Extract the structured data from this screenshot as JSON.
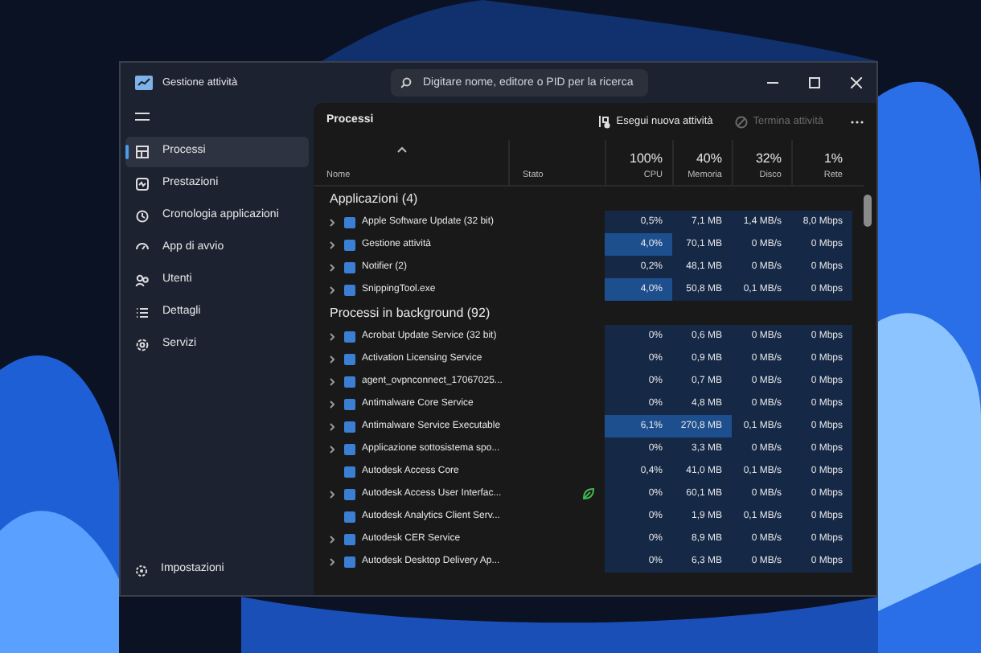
{
  "window": {
    "title": "Gestione attività",
    "search": {
      "placeholder": "Digitare nome, editore o PID per la ricerca"
    }
  },
  "sidebar": {
    "items": [
      {
        "label": "Processi",
        "selected": true
      },
      {
        "label": "Prestazioni",
        "selected": false
      },
      {
        "label": "Cronologia applicazioni",
        "selected": false
      },
      {
        "label": "App di avvio",
        "selected": false
      },
      {
        "label": "Utenti",
        "selected": false
      },
      {
        "label": "Dettagli",
        "selected": false
      },
      {
        "label": "Servizi",
        "selected": false
      }
    ],
    "settings": "Impostazioni"
  },
  "toolbar": {
    "title": "Processi",
    "run_task": "Esegui nuova attività",
    "end_task": {
      "label": "Termina attività",
      "disabled": true
    }
  },
  "table": {
    "columns": [
      {
        "label": "Nome"
      },
      {
        "label": "Stato"
      },
      {
        "label": "CPU",
        "usage": "100%"
      },
      {
        "label": "Memoria",
        "usage": "40%"
      },
      {
        "label": "Disco",
        "usage": "32%"
      },
      {
        "label": "Rete",
        "usage": "1%"
      }
    ],
    "groups": [
      {
        "title": "Applicazioni (4)",
        "rows": [
          {
            "name": "Apple Software Update (32 bit)",
            "expandable": true,
            "efficiency": false,
            "cpu": "0,5%",
            "memory": "7,1 MB",
            "disk": "1,4 MB/s",
            "network": "8,0 Mbps",
            "cpu_hot": false,
            "memory_hot": false
          },
          {
            "name": "Gestione attività",
            "expandable": true,
            "efficiency": false,
            "cpu": "4,0%",
            "memory": "70,1 MB",
            "disk": "0 MB/s",
            "network": "0 Mbps",
            "cpu_hot": true,
            "memory_hot": false
          },
          {
            "name": "Notifier (2)",
            "expandable": true,
            "efficiency": false,
            "cpu": "0,2%",
            "memory": "48,1 MB",
            "disk": "0 MB/s",
            "network": "0 Mbps",
            "cpu_hot": false,
            "memory_hot": false
          },
          {
            "name": "SnippingTool.exe",
            "expandable": true,
            "efficiency": false,
            "cpu": "4,0%",
            "memory": "50,8 MB",
            "disk": "0,1 MB/s",
            "network": "0 Mbps",
            "cpu_hot": true,
            "memory_hot": false
          }
        ]
      },
      {
        "title": "Processi in background (92)",
        "rows": [
          {
            "name": "Acrobat Update Service (32 bit)",
            "expandable": true,
            "efficiency": false,
            "cpu": "0%",
            "memory": "0,6 MB",
            "disk": "0 MB/s",
            "network": "0 Mbps",
            "cpu_hot": false,
            "memory_hot": false
          },
          {
            "name": "Activation Licensing Service",
            "expandable": true,
            "efficiency": false,
            "cpu": "0%",
            "memory": "0,9 MB",
            "disk": "0 MB/s",
            "network": "0 Mbps",
            "cpu_hot": false,
            "memory_hot": false
          },
          {
            "name": "agent_ovpnconnect_17067025...",
            "expandable": true,
            "efficiency": false,
            "cpu": "0%",
            "memory": "0,7 MB",
            "disk": "0 MB/s",
            "network": "0 Mbps",
            "cpu_hot": false,
            "memory_hot": false
          },
          {
            "name": "Antimalware Core Service",
            "expandable": true,
            "efficiency": false,
            "cpu": "0%",
            "memory": "4,8 MB",
            "disk": "0 MB/s",
            "network": "0 Mbps",
            "cpu_hot": false,
            "memory_hot": false
          },
          {
            "name": "Antimalware Service Executable",
            "expandable": true,
            "efficiency": false,
            "cpu": "6,1%",
            "memory": "270,8 MB",
            "disk": "0,1 MB/s",
            "network": "0 Mbps",
            "cpu_hot": true,
            "memory_hot": true
          },
          {
            "name": "Applicazione sottosistema spo...",
            "expandable": true,
            "efficiency": false,
            "cpu": "0%",
            "memory": "3,3 MB",
            "disk": "0 MB/s",
            "network": "0 Mbps",
            "cpu_hot": false,
            "memory_hot": false
          },
          {
            "name": "Autodesk Access Core",
            "expandable": false,
            "efficiency": false,
            "cpu": "0,4%",
            "memory": "41,0 MB",
            "disk": "0,1 MB/s",
            "network": "0 Mbps",
            "cpu_hot": false,
            "memory_hot": false
          },
          {
            "name": "Autodesk Access User Interfac...",
            "expandable": true,
            "efficiency": true,
            "cpu": "0%",
            "memory": "60,1 MB",
            "disk": "0 MB/s",
            "network": "0 Mbps",
            "cpu_hot": false,
            "memory_hot": false
          },
          {
            "name": "Autodesk Analytics Client Serv...",
            "expandable": false,
            "efficiency": false,
            "cpu": "0%",
            "memory": "1,9 MB",
            "disk": "0,1 MB/s",
            "network": "0 Mbps",
            "cpu_hot": false,
            "memory_hot": false
          },
          {
            "name": "Autodesk CER Service",
            "expandable": true,
            "efficiency": false,
            "cpu": "0%",
            "memory": "8,9 MB",
            "disk": "0 MB/s",
            "network": "0 Mbps",
            "cpu_hot": false,
            "memory_hot": false
          },
          {
            "name": "Autodesk Desktop Delivery Ap...",
            "expandable": true,
            "efficiency": false,
            "cpu": "0%",
            "memory": "6,3 MB",
            "disk": "0 MB/s",
            "network": "0 Mbps",
            "cpu_hot": false,
            "memory_hot": false
          }
        ]
      }
    ]
  }
}
